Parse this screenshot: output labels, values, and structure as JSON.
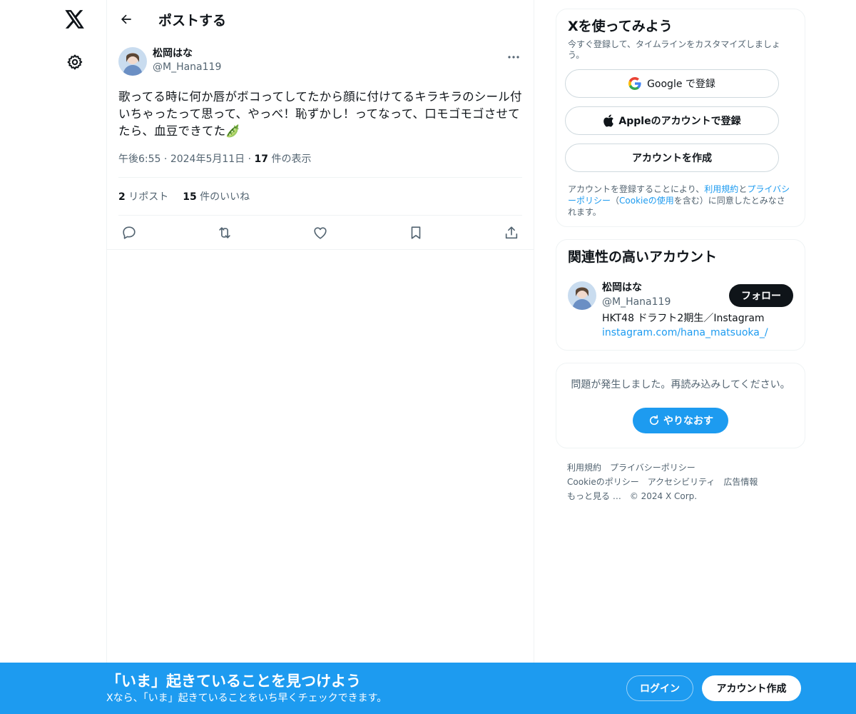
{
  "header": {
    "title": "ポストする"
  },
  "post": {
    "author_name": "松岡はな",
    "author_handle": "@M_Hana119",
    "text": "歌ってる時に何か唇がボコってしてたから顔に付けてるキラキラのシール付いちゃったって思って、やっべ！恥ずかし！ってなって、口モゴモゴさせてたら、血豆できてた🫛",
    "time": "午後6:55",
    "date": "2024年5月11日",
    "separator": "·",
    "views_count": "17",
    "views_label": "件の表示",
    "reposts_count": "2",
    "reposts_label": "リポスト",
    "likes_count": "15",
    "likes_label": "件のいいね"
  },
  "signup_card": {
    "title": "Xを使ってみよう",
    "subtitle": "今すぐ登録して、タイムラインをカスタマイズしましょう。",
    "google_button": "Google で登録",
    "apple_button": "Appleのアカウントで登録",
    "create_button": "アカウントを作成",
    "legal_prefix": "アカウントを登録することにより、",
    "legal_terms": "利用規約",
    "legal_and": "と",
    "legal_privacy": "プライバシーポリシー",
    "legal_paren_open": "（",
    "legal_cookie": "Cookieの使用",
    "legal_suffix": "を含む）に同意したとみなされます。"
  },
  "related_card": {
    "title": "関連性の高いアカウント",
    "name": "松岡はな",
    "handle": "@M_Hana119",
    "bio": "HKT48 ドラフト2期生／Instagram",
    "link": "instagram.com/hana_matsuoka_/",
    "follow_button": "フォロー"
  },
  "error_card": {
    "message": "問題が発生しました。再読み込みしてください。",
    "retry_button": "やりなおす"
  },
  "footer": {
    "terms": "利用規約",
    "privacy": "プライバシーポリシー",
    "cookie": "Cookieのポリシー",
    "accessibility": "アクセシビリティ",
    "ads": "広告情報",
    "more": "もっと見る …",
    "copyright": "© 2024 X Corp."
  },
  "banner": {
    "title": "「いま」起きていることを見つけよう",
    "subtitle": "Xなら、「いま」起きていることをいち早くチェックできます。",
    "login_button": "ログイン",
    "create_button": "アカウント作成"
  },
  "colors": {
    "accent": "#1d9bf0",
    "text": "#0f1419",
    "muted": "#536471",
    "border": "#eff3f4"
  },
  "icons": [
    "x-logo-icon",
    "gear-icon",
    "back-arrow-icon",
    "more-icon",
    "reply-icon",
    "repost-icon",
    "like-icon",
    "bookmark-icon",
    "share-icon",
    "google-icon",
    "apple-icon",
    "refresh-icon"
  ]
}
